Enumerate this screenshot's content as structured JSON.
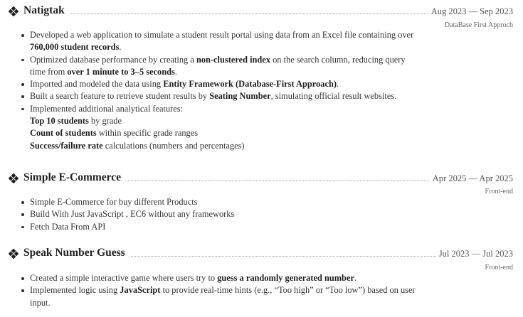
{
  "projects": [
    {
      "title": "Natigtak",
      "dates": "Aug 2023 — Sep 2023",
      "sub": "DataBase First Approch",
      "bullets": [
        {
          "a": "Developed a web application to simulate a student result portal using data from an Excel file containing over ",
          "b": "760,000 student records",
          "c": "."
        },
        {
          "a": "Optimized database performance by creating a ",
          "b": "non-clustered index",
          "c": " on the search column, reducing query time from ",
          "b2": "over 1 minute to 3–5 seconds",
          "c2": "."
        },
        {
          "a": "Imported and modeled the data using ",
          "b": "Entity Framework (Database-First Approach)",
          "c": "."
        },
        {
          "a": "Built a search feature to retrieve student results by ",
          "b": "Seating Number",
          "c": ", simulating official result websites."
        },
        {
          "a": "Implemented additional analytical features:"
        }
      ],
      "features": [
        {
          "b": "Top 10 students",
          "c": " by grade"
        },
        {
          "b": "Count of students",
          "c": " within specific grade ranges"
        },
        {
          "b": "Success/failure rate",
          "c": " calculations (numbers and percentages)"
        }
      ]
    },
    {
      "title": "Simple E-Commerce",
      "dates": "Apr 2025 — Apr 2025",
      "sub": "Front-end",
      "bullets": [
        {
          "a": "Simple E-Commerce for buy different Products"
        },
        {
          "a": "Build With Just JavaScript , EC6 without any frameworks"
        },
        {
          "a": "Fetch Data From API"
        }
      ]
    },
    {
      "title": "Speak Number Guess",
      "dates": "Jul 2023 — Jul 2023",
      "sub": "Front-end",
      "bullets": [
        {
          "a": "Created a simple interactive game where users try to ",
          "b": "guess a randomly generated number",
          "c": "."
        },
        {
          "a": "Implemented logic using ",
          "b": "JavaScript",
          "c": " to provide real-time hints (e.g., “Too high” or “Too low”) based on user input."
        }
      ]
    }
  ],
  "icons": {
    "section_icon": "diamond-bullet-icon"
  }
}
